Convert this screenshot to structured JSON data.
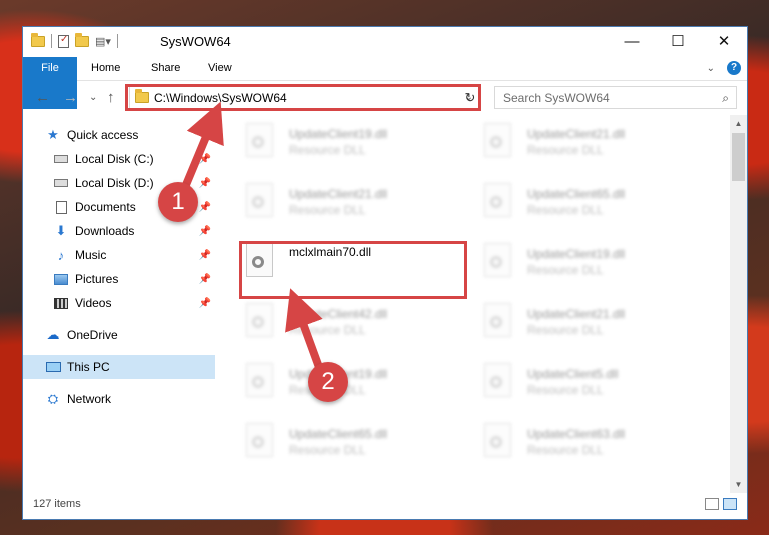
{
  "window": {
    "title": "SysWOW64",
    "controls": {
      "minimize": "—",
      "maximize": "☐",
      "close": "✕"
    }
  },
  "ribbon": {
    "tabs": [
      {
        "label": "File"
      },
      {
        "label": "Home"
      },
      {
        "label": "Share"
      },
      {
        "label": "View"
      }
    ],
    "help": "?"
  },
  "nav": {
    "address": "C:\\Windows\\SysWOW64",
    "search_placeholder": "Search SysWOW64"
  },
  "sidebar": {
    "items": [
      {
        "label": "Quick access",
        "icon": "star-icon"
      },
      {
        "label": "Local Disk (C:)",
        "icon": "drive-icon",
        "pinned": true
      },
      {
        "label": "Local Disk (D:)",
        "icon": "drive-icon",
        "pinned": true
      },
      {
        "label": "Documents",
        "icon": "documents-icon",
        "pinned": true
      },
      {
        "label": "Downloads",
        "icon": "downloads-icon",
        "pinned": true
      },
      {
        "label": "Music",
        "icon": "music-icon",
        "pinned": true
      },
      {
        "label": "Pictures",
        "icon": "pictures-icon",
        "pinned": true
      },
      {
        "label": "Videos",
        "icon": "videos-icon",
        "pinned": true
      },
      {
        "label": "OneDrive",
        "icon": "onedrive-icon"
      },
      {
        "label": "This PC",
        "icon": "this-pc-icon",
        "selected": true
      },
      {
        "label": "Network",
        "icon": "network-icon"
      }
    ]
  },
  "files": {
    "left": [
      {
        "name": "UpdateClient19.dll",
        "type": "Resource DLL"
      },
      {
        "name": "UpdateClient21.dll",
        "type": "Resource DLL"
      },
      {
        "name": "mclxlmain70.dll",
        "type": ""
      },
      {
        "name": "UpdateClient42.dll",
        "type": "Resource DLL"
      },
      {
        "name": "UpdateClient19.dll",
        "type": "Resource DLL"
      },
      {
        "name": "UpdateClient65.dll",
        "type": "Resource DLL"
      }
    ],
    "right": [
      {
        "name": "UpdateClient21.dll",
        "type": "Resource DLL"
      },
      {
        "name": "UpdateClient65.dll",
        "type": "Resource DLL"
      },
      {
        "name": "UpdateClient19.dll",
        "type": "Resource DLL"
      },
      {
        "name": "UpdateClient21.dll",
        "type": "Resource DLL"
      },
      {
        "name": "UpdateClient5.dll",
        "type": "Resource DLL"
      },
      {
        "name": "UpdateClient63.dll",
        "type": "Resource DLL"
      }
    ]
  },
  "status": {
    "item_count": "127 items"
  },
  "annotations": {
    "step1": "1",
    "step2": "2",
    "color": "#d64545"
  }
}
